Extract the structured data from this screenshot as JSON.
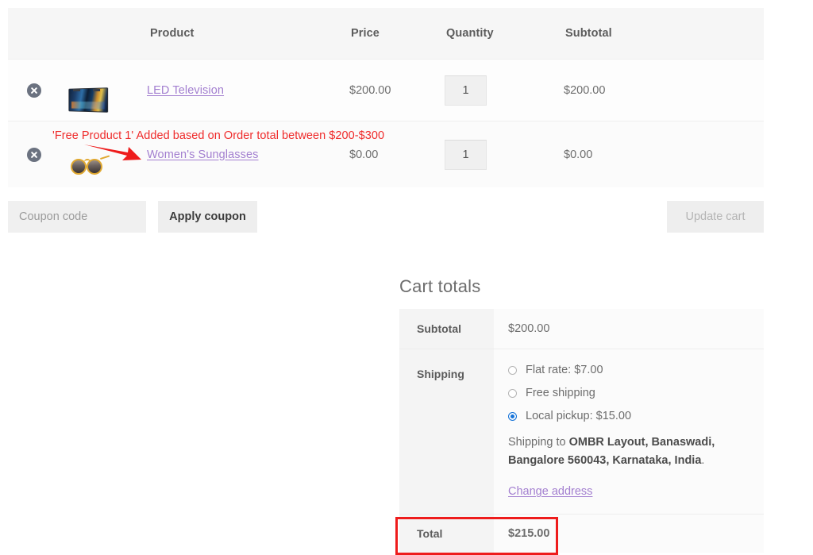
{
  "cart_table": {
    "headers": {
      "remove": "",
      "thumbnail": "",
      "product": "Product",
      "price": "Price",
      "quantity": "Quantity",
      "subtotal": "Subtotal"
    },
    "rows": [
      {
        "remove_icon": "remove-circle-icon",
        "thumbnail_icon": "led-television-thumbnail",
        "name": "LED Television",
        "price": "$200.00",
        "quantity": "1",
        "subtotal": "$200.00"
      },
      {
        "remove_icon": "remove-circle-icon",
        "thumbnail_icon": "womens-sunglasses-thumbnail",
        "name": "Women's Sunglasses",
        "price": "$0.00",
        "quantity": "1",
        "subtotal": "$0.00"
      }
    ]
  },
  "annotations": {
    "free_product_note": "'Free Product 1' Added based on Order total between $200-$300",
    "note_color": "#ef2b2b",
    "arrow_icon": "red-arrow-right-icon",
    "highlight_box_icon": "red-highlight-box",
    "highlight_color": "#ee1c1c"
  },
  "coupon": {
    "placeholder": "Coupon code",
    "value": "",
    "apply_label": "Apply coupon",
    "update_cart_label": "Update cart"
  },
  "cart_totals": {
    "title": "Cart totals",
    "subtotal_label": "Subtotal",
    "subtotal_value": "$200.00",
    "shipping_label": "Shipping",
    "shipping_options": [
      {
        "label": "Flat rate: $7.00",
        "selected": false
      },
      {
        "label": "Free shipping",
        "selected": false
      },
      {
        "label": "Local pickup: $15.00",
        "selected": true
      }
    ],
    "shipping_to_prefix": "Shipping to ",
    "shipping_to_address": "OMBR Layout, Banaswadi, Bangalore 560043, Karnataka, India",
    "shipping_to_suffix": ".",
    "change_address_label": "Change address",
    "total_label": "Total",
    "total_value": "$215.00",
    "selected_radio_color": "#1573d8"
  },
  "theme": {
    "link_color": "#a37fd0",
    "header_bg": "#f6f6f6",
    "text_color": "#6d6d6d"
  }
}
